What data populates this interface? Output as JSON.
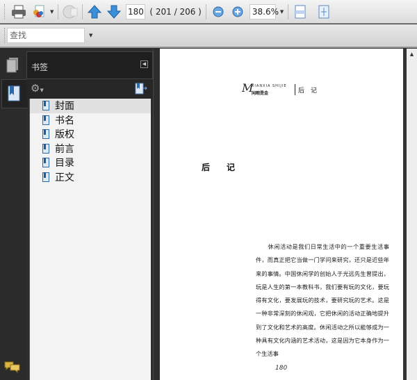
{
  "toolbar": {
    "page_input": "180",
    "page_label": "( 201 / 206 )",
    "zoom_value": "38.6%"
  },
  "findbar": {
    "placeholder": "查找"
  },
  "panel": {
    "title": "书签",
    "bookmarks": [
      {
        "label": "封面"
      },
      {
        "label": "书名"
      },
      {
        "label": "版权"
      },
      {
        "label": "前言"
      },
      {
        "label": "目录"
      },
      {
        "label": "正文"
      }
    ]
  },
  "document": {
    "header_logo_text": "XIANXIA SHIJIE",
    "header_logo_cn": "闲暇是金",
    "header_title": "后　记",
    "section_title": "后　　记",
    "paragraph": "　　休闲活动是我们日常生活中的一个重要生活事件，而真正把它当做一门学问来研究，还只是近些年来的事情。中国休闲学的创始人于光远先生曾提出，玩是人生的第一本教科书，我们要有玩的文化，要玩得有文化，要发展玩的技术，要研究玩的艺术。这是一种非常深刻的休闲观，它把休闲的活动正确地提升到了文化和艺术的高度。休闲活动之所以能够成为一种具有文化内涵的艺术活动，这是因为它本身作为一个生活事",
    "page_number": "180"
  }
}
